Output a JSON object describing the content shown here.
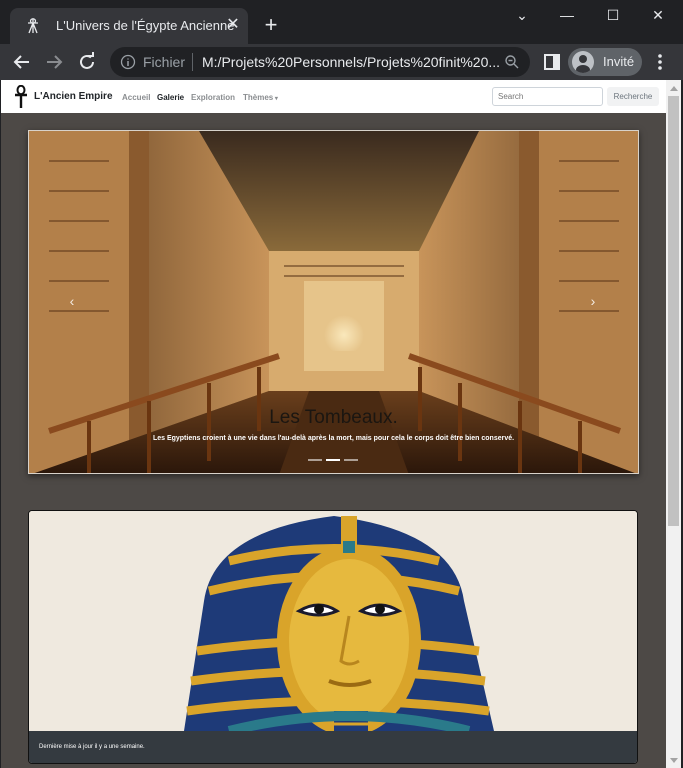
{
  "browser": {
    "tab_title": "L'Univers de l'Égypte Ancienne",
    "address_scheme": "Fichier",
    "address_url": "M:/Projets%20Personnels/Projets%20finit%20...",
    "profile_label": "Invité",
    "accent": "#35363a"
  },
  "navbar": {
    "brand": "L'Ancien Empire",
    "links": [
      "Accueil",
      "Galerie",
      "Exploration",
      "Thèmes"
    ],
    "active_link": "Galerie",
    "search_placeholder": "Search",
    "search_button": "Recherche"
  },
  "carousel": {
    "caption_title": "Les Tombeaux.",
    "caption_text": "Les Egyptiens croient à une vie dans l'au-delà après la mort, mais pour cela le corps doit être bien conservé.",
    "slide_count": 3,
    "active_slide": 2
  },
  "card": {
    "footer_text": "Dernière mise à jour il y a une semaine."
  }
}
